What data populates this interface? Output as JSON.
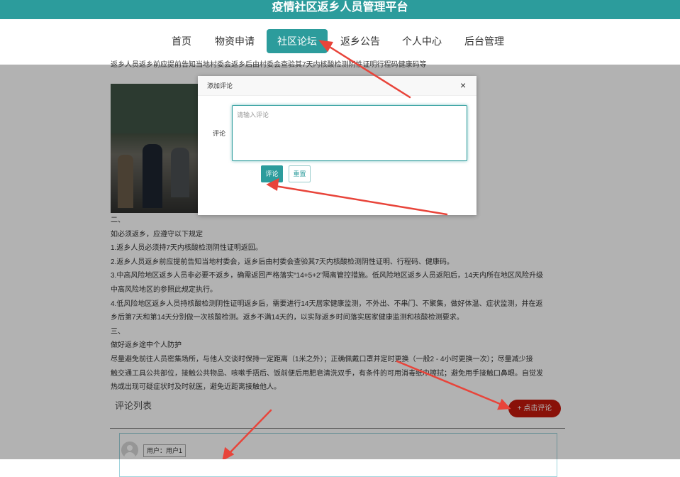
{
  "app": {
    "title": "疫情社区返乡人员管理平台"
  },
  "nav": {
    "items": [
      {
        "label": "首页"
      },
      {
        "label": "物资申请"
      },
      {
        "label": "社区论坛",
        "active": true
      },
      {
        "label": "返乡公告"
      },
      {
        "label": "个人中心"
      },
      {
        "label": "后台管理"
      }
    ]
  },
  "article": {
    "intro_cut": "返乡人员返乡前应提前告知当地村委会返乡后由村委会查验其7天内核酸检测阴性证明行程码健康码等",
    "lines": [
      "二、",
      "如必须返乡，应遵守以下规定",
      "1.返乡人员必须持7天内核酸检测阴性证明返回。",
      "2.返乡人员返乡前应提前告知当地村委会，返乡后由村委会查验其7天内核酸检测阴性证明、行程码、健康码。",
      "3.中高风险地区返乡人员非必要不返乡，确需返回严格落实“14+5+2”隔离管控措施。低风险地区返乡人员返阳后，14天内所在地区风险升级",
      "中高风险地区的参照此规定执行。",
      "4.低风险地区返乡人员持核酸检测阴性证明返乡后，需要进行14天居家健康监测，不外出、不串门、不聚集，做好体温、症状监测，并在返",
      "乡后第7天和第14天分别做一次核酸检测。返乡不满14天的，以实际返乡时间落实居家健康监测和核酸检测要求。",
      "三、",
      "做好返乡途中个人防护",
      "尽量避免前往人员密集场所，与他人交谈时保持一定距离（1米之外）；正确佩戴口罩并定时更换（一般2 - 4小时更换一次）；尽量减少接",
      "触交通工具公共部位，接触公共物品、咳嗽手捂后、饭前便后用肥皂清洗双手，有条件的可用消毒纸巾擦拭；避免用手接触口鼻眼。自觉发",
      "热或出现可疑症状时及时就医，避免近距离接触他人。"
    ]
  },
  "comments": {
    "title": "评论列表",
    "add_button": "+ 点击评论",
    "list": [
      {
        "user": "用户：用户1"
      }
    ]
  },
  "dialog": {
    "title": "添加评论",
    "close": "×",
    "field_label": "评论",
    "placeholder": "请输入评论",
    "value": "",
    "submit": "评论",
    "reset": "重置"
  },
  "colors": {
    "brand": "#2c9c9c",
    "danger": "#c4190c",
    "annotation_arrow": "#e8443a"
  }
}
